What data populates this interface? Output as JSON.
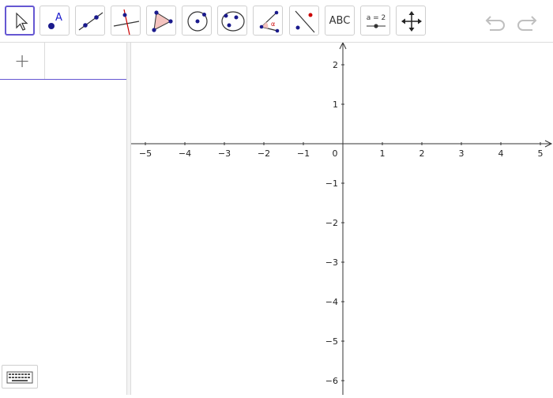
{
  "toolbar": {
    "tools": [
      {
        "id": "move",
        "icon": "arrow-cursor-icon"
      },
      {
        "id": "point",
        "icon": "point-icon",
        "label": "A"
      },
      {
        "id": "line",
        "icon": "line-through-points-icon"
      },
      {
        "id": "perpendicular",
        "icon": "perpendicular-line-icon"
      },
      {
        "id": "polygon",
        "icon": "polygon-icon"
      },
      {
        "id": "circle",
        "icon": "circle-center-point-icon"
      },
      {
        "id": "ellipse",
        "icon": "conic-icon"
      },
      {
        "id": "angle",
        "icon": "angle-icon",
        "label": "α"
      },
      {
        "id": "reflect",
        "icon": "reflect-about-line-icon"
      },
      {
        "id": "text",
        "icon": "text-icon",
        "label": "ABC"
      },
      {
        "id": "slider",
        "icon": "slider-icon",
        "label": "a = 2"
      },
      {
        "id": "move-graphics",
        "icon": "move-graphics-view-icon"
      }
    ],
    "undo_icon": "undo-icon",
    "redo_icon": "redo-icon"
  },
  "algebra": {
    "add_symbol": "+",
    "add_icon": "plus-icon"
  },
  "keyboard": {
    "icon": "keyboard-icon"
  },
  "colors": {
    "accent": "#6557d2",
    "point": "#1a1a8c",
    "polygon_fill": "#f4c3bf",
    "red": "#cc0000"
  },
  "graph": {
    "x_ticks": [
      "−5",
      "−4",
      "−3",
      "−2",
      "−1",
      "0",
      "1",
      "2",
      "3",
      "4",
      "5"
    ],
    "y_ticks_pos": [
      "2",
      "1"
    ],
    "y_ticks_neg": [
      "−1",
      "−2",
      "−3",
      "−4",
      "−5",
      "−6"
    ]
  }
}
